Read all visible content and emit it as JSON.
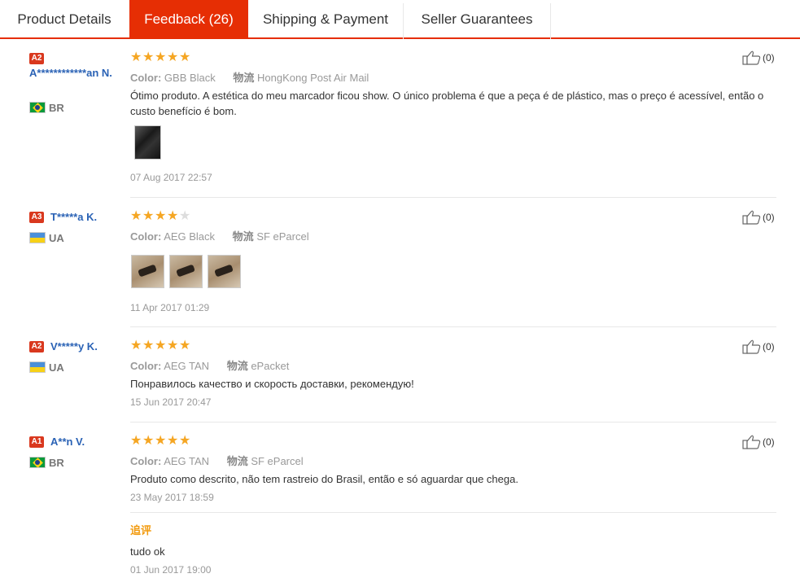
{
  "tabs": [
    {
      "label": "Product Details",
      "active": false
    },
    {
      "label": "Feedback (26)",
      "active": true
    },
    {
      "label": "Shipping & Payment",
      "active": false
    },
    {
      "label": "Seller Guarantees",
      "active": false
    }
  ],
  "labels": {
    "color": "Color:",
    "shipping": "物流",
    "additional_feedback": "追评"
  },
  "reviews": [
    {
      "level": "A2",
      "name": "A************an N.",
      "country": "BR",
      "stars": 5,
      "color": "GBB Black",
      "shipping": "HongKong Post Air Mail",
      "text": "Ótimo produto. A estética do meu marcador ficou show. O único problema é que a peça é de plástico, mas o preço é acessível, então o custo benefício é bom.",
      "date": "07 Aug 2017 22:57",
      "helpful": "(0)"
    },
    {
      "level": "A3",
      "name": "T*****a K.",
      "country": "UA",
      "stars": 4,
      "color": "AEG Black",
      "shipping": "SF eParcel",
      "text": "",
      "date": "11 Apr 2017 01:29",
      "helpful": "(0)"
    },
    {
      "level": "A2",
      "name": "V*****y K.",
      "country": "UA",
      "stars": 5,
      "color": "AEG TAN",
      "shipping": "ePacket",
      "text": "Понравилось качество и скорость доставки, рекомендую!",
      "date": "15 Jun 2017 20:47",
      "helpful": "(0)"
    },
    {
      "level": "A1",
      "name": "A**n V.",
      "country": "BR",
      "stars": 5,
      "color": "AEG TAN",
      "shipping": "SF eParcel",
      "text": "Produto como descrito, não tem rastreio do Brasil, então e só aguardar que chega.",
      "date": "23 May 2017 18:59",
      "helpful": "(0)",
      "additional": {
        "text": "tudo ok",
        "date": "01 Jun 2017 19:00"
      }
    }
  ],
  "colors": {
    "accent": "#e62e04",
    "star": "#f5a623",
    "username": "#2a62b5",
    "additional_label": "#f29a0d"
  }
}
